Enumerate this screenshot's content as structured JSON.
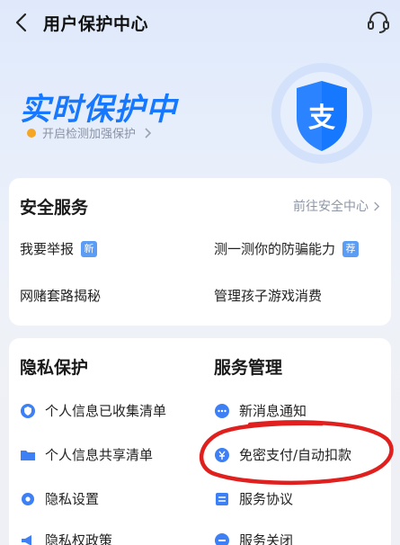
{
  "header": {
    "title": "用户保护中心",
    "back_icon": "chevron-left-icon",
    "support_icon": "headset-icon"
  },
  "hero": {
    "title": "实时保护中",
    "subtitle": "开启检测加强保护",
    "subtitle_dot_color": "#f5a623",
    "shield_char": "支",
    "accent": "#1677ff"
  },
  "security": {
    "title": "安全服务",
    "more_link": "前往安全中心",
    "items": [
      {
        "label": "我要举报",
        "badge": "新"
      },
      {
        "label": "测一测你的防骗能力",
        "badge": "荐"
      },
      {
        "label": "网赌套路揭秘"
      },
      {
        "label": "管理孩子游戏消费"
      }
    ]
  },
  "privacy": {
    "title": "隐私保护",
    "items": [
      {
        "label": "个人信息已收集清单",
        "icon": "shield-circle-icon"
      },
      {
        "label": "个人信息共享清单",
        "icon": "folder-icon"
      },
      {
        "label": "隐私设置",
        "icon": "gear-icon"
      },
      {
        "label": "隐私权政策",
        "icon": "megaphone-icon"
      }
    ]
  },
  "service": {
    "title": "服务管理",
    "items": [
      {
        "label": "新消息通知",
        "icon": "chat-bubble-icon"
      },
      {
        "label": "免密支付/自动扣款",
        "icon": "payment-circle-icon"
      },
      {
        "label": "服务协议",
        "icon": "document-icon"
      },
      {
        "label": "服务关闭",
        "icon": "minus-circle-icon"
      }
    ]
  },
  "annotation_color": "#e0201e"
}
